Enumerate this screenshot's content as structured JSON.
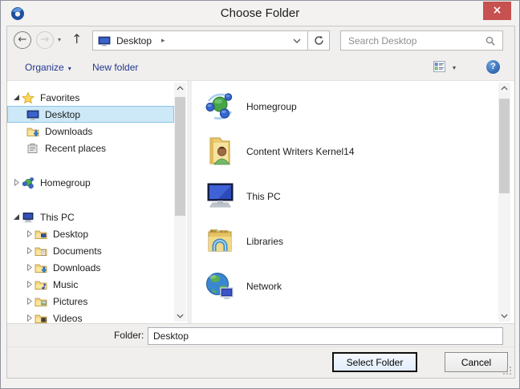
{
  "window": {
    "title": "Choose Folder"
  },
  "icons": {
    "close": "×",
    "back": "←",
    "forward": "→",
    "up": "↑",
    "caret_down": "▾",
    "crumb_arrow": "▸",
    "help": "?"
  },
  "nav": {
    "location": "Desktop",
    "search_placeholder": "Search Desktop"
  },
  "toolbar": {
    "organize": "Organize",
    "new_folder": "New folder"
  },
  "sidebar": {
    "items": [
      {
        "label": "Favorites"
      },
      {
        "label": "Desktop"
      },
      {
        "label": "Downloads"
      },
      {
        "label": "Recent places"
      },
      {
        "label": "Homegroup"
      },
      {
        "label": "This PC"
      },
      {
        "label": "Desktop"
      },
      {
        "label": "Documents"
      },
      {
        "label": "Downloads"
      },
      {
        "label": "Music"
      },
      {
        "label": "Pictures"
      },
      {
        "label": "Videos"
      }
    ]
  },
  "files": {
    "items": [
      {
        "label": "Homegroup"
      },
      {
        "label": "Content Writers Kernel14"
      },
      {
        "label": "This PC"
      },
      {
        "label": "Libraries"
      },
      {
        "label": "Network"
      }
    ]
  },
  "footer": {
    "folder_label": "Folder:",
    "folder_value": "Desktop",
    "select_label": "Select Folder",
    "cancel_label": "Cancel"
  },
  "colors": {
    "selection_bg": "#cde8f6",
    "selection_border": "#8ac6ea",
    "close_red": "#c75050",
    "toolbar_blue": "#24388f"
  }
}
